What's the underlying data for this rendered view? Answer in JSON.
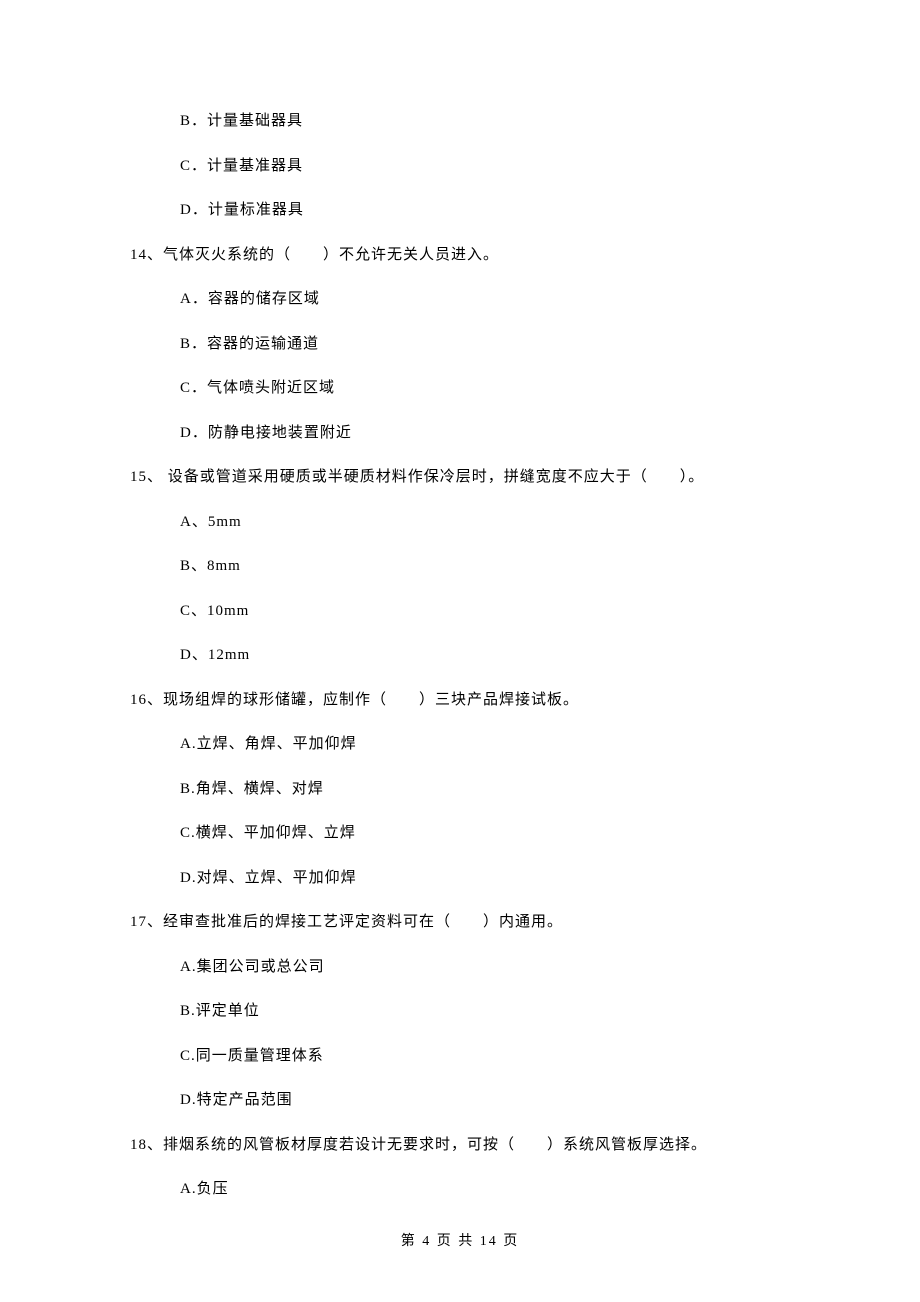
{
  "orphan_options": [
    "B．计量基础器具",
    "C．计量基准器具",
    "D．计量标准器具"
  ],
  "questions": [
    {
      "stem": "14、气体灭火系统的（　　）不允许无关人员进入。",
      "options": [
        "A．容器的储存区域",
        "B．容器的运输通道",
        "C．气体喷头附近区域",
        "D．防静电接地装置附近"
      ]
    },
    {
      "stem": "15、 设备或管道采用硬质或半硬质材料作保冷层时，拼缝宽度不应大于（　　）。",
      "options": [
        "A、5mm",
        "B、8mm",
        "C、10mm",
        "D、12mm"
      ]
    },
    {
      "stem": "16、现场组焊的球形储罐，应制作（　　）三块产品焊接试板。",
      "options": [
        "A.立焊、角焊、平加仰焊",
        "B.角焊、横焊、对焊",
        "C.横焊、平加仰焊、立焊",
        "D.对焊、立焊、平加仰焊"
      ]
    },
    {
      "stem": "17、经审查批准后的焊接工艺评定资料可在（　　）内通用。",
      "options": [
        "A.集团公司或总公司",
        "B.评定单位",
        "C.同一质量管理体系",
        "D.特定产品范围"
      ]
    },
    {
      "stem": "18、排烟系统的风管板材厚度若设计无要求时，可按（　　）系统风管板厚选择。",
      "options": [
        "A.负压"
      ]
    }
  ],
  "footer": "第 4 页 共 14 页"
}
